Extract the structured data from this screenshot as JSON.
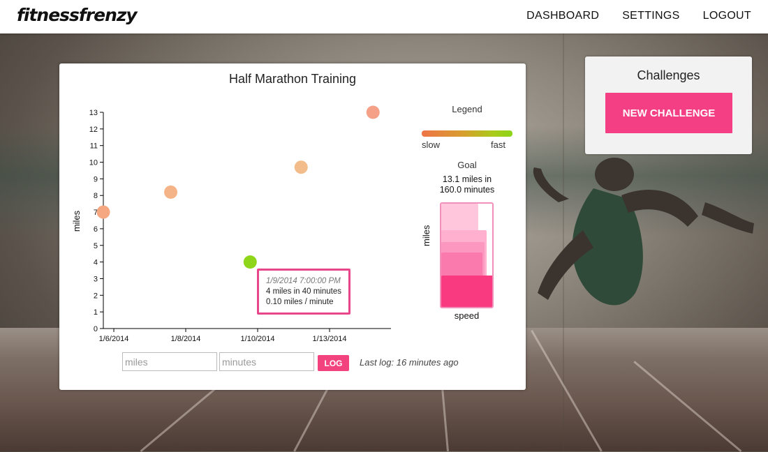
{
  "nav": {
    "logo": "fitnessfrenzy",
    "items": [
      "DASHBOARD",
      "SETTINGS",
      "LOGOUT"
    ]
  },
  "card": {
    "title": "Half Marathon Training"
  },
  "chart_data": {
    "type": "scatter",
    "title": "Half Marathon Training",
    "ylabel": "miles",
    "xlabel": "",
    "ylim": [
      0,
      13
    ],
    "xlim": [
      "2014-01-05 17:00",
      "2014-01-13 17:00"
    ],
    "x_tick_labels": [
      "1/6/2014",
      "1/8/2014",
      "1/10/2014",
      "1/13/2014"
    ],
    "x_tick_dates": [
      "2014-01-06",
      "2014-01-08",
      "2014-01-10",
      "2014-01-12"
    ],
    "y_ticks": [
      0,
      1,
      2,
      3,
      4,
      5,
      6,
      7,
      8,
      9,
      10,
      11,
      12,
      13
    ],
    "points": [
      {
        "x": "2014-01-05 17:00",
        "y": 7,
        "color": "#f5a781"
      },
      {
        "x": "2014-01-07 14:00",
        "y": 8.2,
        "color": "#f4b487"
      },
      {
        "x": "2014-01-09 19:00",
        "y": 4,
        "color": "#8fd61b"
      },
      {
        "x": "2014-01-11 05:00",
        "y": 9.7,
        "color": "#f3bd8b"
      },
      {
        "x": "2014-01-13 05:00",
        "y": 13,
        "color": "#f4a188"
      }
    ]
  },
  "tooltip": {
    "date": "1/9/2014 7:00:00 PM",
    "line1": "4 miles in 40 minutes",
    "line2": "0.10 miles / minute"
  },
  "legend": {
    "title": "Legend",
    "slow": "slow",
    "fast": "fast",
    "colors": [
      "#ee7448",
      "#8cd51a"
    ]
  },
  "goal": {
    "title": "Goal",
    "line1": "13.1 miles in",
    "line2": "160.0 minutes",
    "ylabel": "miles",
    "xlabel": "speed"
  },
  "log_form": {
    "miles_placeholder": "miles",
    "minutes_placeholder": "minutes",
    "button": "LOG",
    "last_log": "Last log: 16 minutes ago"
  },
  "challenges": {
    "title": "Challenges",
    "button": "NEW CHALLENGE"
  },
  "accent_color": "#f43f85"
}
